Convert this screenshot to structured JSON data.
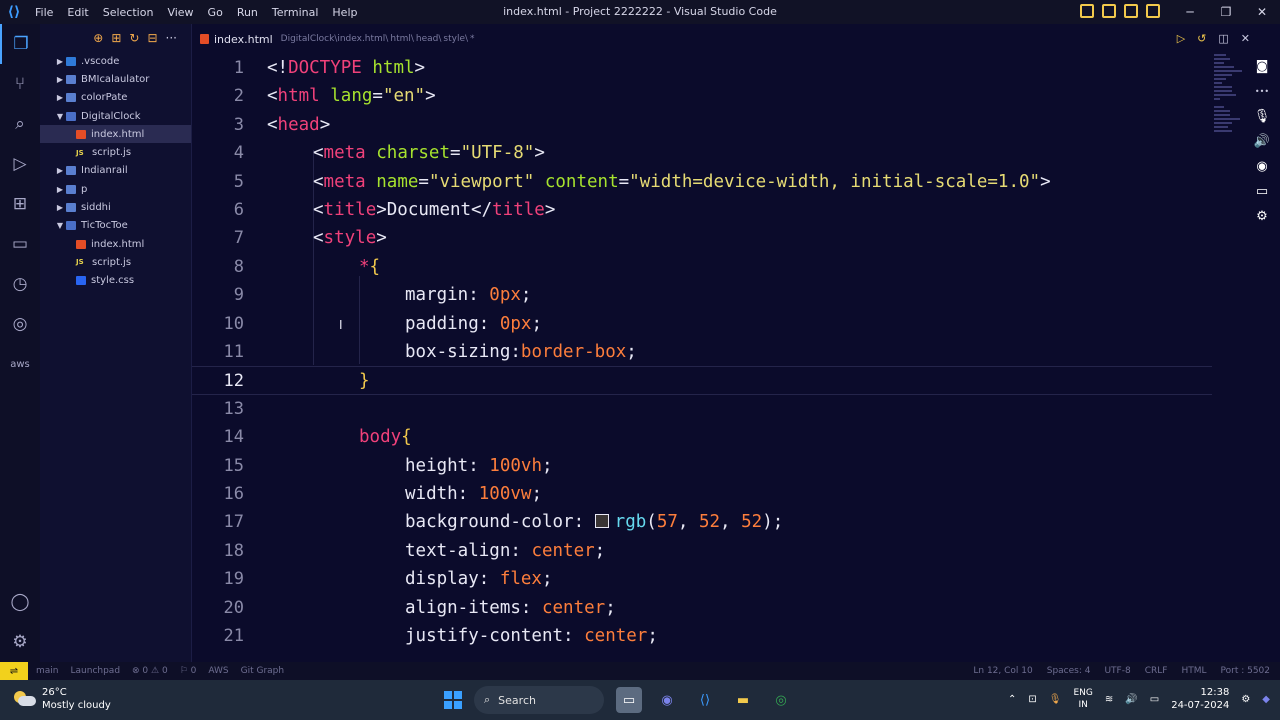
{
  "titlebar": {
    "menu": [
      "File",
      "Edit",
      "Selection",
      "View",
      "Go",
      "Run",
      "Terminal",
      "Help"
    ],
    "window_title": "index.html - Project 2222222 - Visual Studio Code"
  },
  "explorer": {
    "items": [
      {
        "label": ".vscode",
        "type": "folder",
        "depth": 1,
        "open": false
      },
      {
        "label": "BMIcalaulator",
        "type": "folder",
        "depth": 1,
        "open": false
      },
      {
        "label": "colorPate",
        "type": "folder",
        "depth": 1,
        "open": false
      },
      {
        "label": "DigitalClock",
        "type": "folder",
        "depth": 1,
        "open": true
      },
      {
        "label": "index.html",
        "type": "html",
        "depth": 2,
        "selected": true
      },
      {
        "label": "script.js",
        "type": "js",
        "depth": 2
      },
      {
        "label": "Indianrail",
        "type": "folder",
        "depth": 1,
        "open": false
      },
      {
        "label": "p",
        "type": "folder",
        "depth": 1,
        "open": false
      },
      {
        "label": "siddhi",
        "type": "folder",
        "depth": 1,
        "open": false
      },
      {
        "label": "TicTocToe",
        "type": "folder",
        "depth": 1,
        "open": true
      },
      {
        "label": "index.html",
        "type": "html",
        "depth": 2
      },
      {
        "label": "script.js",
        "type": "js",
        "depth": 2
      },
      {
        "label": "style.css",
        "type": "css",
        "depth": 2
      }
    ]
  },
  "tab": {
    "label": "index.html",
    "breadcrumb": [
      "DigitalClock\\index.html\\",
      "html\\",
      "head\\",
      "style\\",
      "*"
    ]
  },
  "editor": {
    "current_line": 12,
    "lines": [
      {
        "n": "1",
        "indent": 0,
        "tokens": [
          [
            "punc",
            "<!"
          ],
          [
            "doctype",
            "DOCTYPE"
          ],
          [
            "punc",
            " "
          ],
          [
            "attr",
            "html"
          ],
          [
            "punc",
            ">"
          ]
        ]
      },
      {
        "n": "2",
        "indent": 0,
        "tokens": [
          [
            "punc",
            "<"
          ],
          [
            "tag",
            "html"
          ],
          [
            "punc",
            " "
          ],
          [
            "attr",
            "lang"
          ],
          [
            "punc",
            "="
          ],
          [
            "str",
            "\"en\""
          ],
          [
            "punc",
            ">"
          ]
        ]
      },
      {
        "n": "3",
        "indent": 0,
        "tokens": [
          [
            "punc",
            "<"
          ],
          [
            "tag",
            "head"
          ],
          [
            "punc",
            ">"
          ]
        ]
      },
      {
        "n": "4",
        "indent": 1,
        "tokens": [
          [
            "punc",
            "<"
          ],
          [
            "tag",
            "meta"
          ],
          [
            "punc",
            " "
          ],
          [
            "attr",
            "charset"
          ],
          [
            "punc",
            "="
          ],
          [
            "str",
            "\"UTF-8\""
          ],
          [
            "punc",
            ">"
          ]
        ]
      },
      {
        "n": "5",
        "indent": 1,
        "tokens": [
          [
            "punc",
            "<"
          ],
          [
            "tag",
            "meta"
          ],
          [
            "punc",
            " "
          ],
          [
            "attr",
            "name"
          ],
          [
            "punc",
            "="
          ],
          [
            "str",
            "\"viewport\""
          ],
          [
            "punc",
            " "
          ],
          [
            "attr",
            "content"
          ],
          [
            "punc",
            "="
          ],
          [
            "str",
            "\"width=device-width, initial-scale=1.0\""
          ],
          [
            "punc",
            ">"
          ]
        ]
      },
      {
        "n": "6",
        "indent": 1,
        "tokens": [
          [
            "punc",
            "<"
          ],
          [
            "tag",
            "title"
          ],
          [
            "punc",
            ">Document</"
          ],
          [
            "tag",
            "title"
          ],
          [
            "punc",
            ">"
          ]
        ]
      },
      {
        "n": "7",
        "indent": 1,
        "tokens": [
          [
            "punc",
            "<"
          ],
          [
            "tag",
            "style"
          ],
          [
            "punc",
            ">"
          ]
        ]
      },
      {
        "n": "8",
        "indent": 2,
        "tokens": [
          [
            "sel",
            "*"
          ],
          [
            "brace",
            "{"
          ]
        ]
      },
      {
        "n": "9",
        "indent": 3,
        "tokens": [
          [
            "prop",
            "margin: "
          ],
          [
            "num",
            "0"
          ],
          [
            "val",
            "px"
          ],
          [
            "punc",
            ";"
          ]
        ]
      },
      {
        "n": "10",
        "indent": 3,
        "tokens": [
          [
            "prop",
            "padding: "
          ],
          [
            "num",
            "0"
          ],
          [
            "val",
            "px"
          ],
          [
            "punc",
            ";"
          ]
        ]
      },
      {
        "n": "11",
        "indent": 3,
        "tokens": [
          [
            "prop",
            "box-sizing:"
          ],
          [
            "val",
            "border-box"
          ],
          [
            "punc",
            ";"
          ]
        ]
      },
      {
        "n": "12",
        "indent": 2,
        "tokens": [
          [
            "brace",
            "}"
          ]
        ]
      },
      {
        "n": "13",
        "indent": 0,
        "tokens": []
      },
      {
        "n": "14",
        "indent": 2,
        "tokens": [
          [
            "sel",
            "body"
          ],
          [
            "brace",
            "{"
          ]
        ]
      },
      {
        "n": "15",
        "indent": 3,
        "tokens": [
          [
            "prop",
            "height: "
          ],
          [
            "num",
            "100"
          ],
          [
            "val",
            "vh"
          ],
          [
            "punc",
            ";"
          ]
        ]
      },
      {
        "n": "16",
        "indent": 3,
        "tokens": [
          [
            "prop",
            "width: "
          ],
          [
            "num",
            "100"
          ],
          [
            "val",
            "vw"
          ],
          [
            "punc",
            ";"
          ]
        ]
      },
      {
        "n": "17",
        "indent": 3,
        "tokens": [
          [
            "prop",
            "background-color: "
          ],
          [
            "swatch",
            ""
          ],
          [
            "fn",
            "rgb"
          ],
          [
            "punc",
            "("
          ],
          [
            "num",
            "57"
          ],
          [
            "punc",
            ", "
          ],
          [
            "num",
            "52"
          ],
          [
            "punc",
            ", "
          ],
          [
            "num",
            "52"
          ],
          [
            "punc",
            ");"
          ]
        ]
      },
      {
        "n": "18",
        "indent": 3,
        "tokens": [
          [
            "prop",
            "text-align: "
          ],
          [
            "val",
            "center"
          ],
          [
            "punc",
            ";"
          ]
        ]
      },
      {
        "n": "19",
        "indent": 3,
        "tokens": [
          [
            "prop",
            "display: "
          ],
          [
            "val",
            "flex"
          ],
          [
            "punc",
            ";"
          ]
        ]
      },
      {
        "n": "20",
        "indent": 3,
        "tokens": [
          [
            "prop",
            "align-items: "
          ],
          [
            "val",
            "center"
          ],
          [
            "punc",
            ";"
          ]
        ]
      },
      {
        "n": "21",
        "indent": 3,
        "tokens": [
          [
            "prop",
            "justify-content: "
          ],
          [
            "val",
            "center"
          ],
          [
            "punc",
            ";"
          ]
        ]
      }
    ]
  },
  "statusbar": {
    "left": [
      "main",
      "Launchpad",
      "⊗ 0 ⚠ 0",
      "⚐ 0",
      "AWS",
      "Git Graph"
    ],
    "right": [
      "Ln 12, Col 10",
      "Spaces: 4",
      "UTF-8",
      "CRLF",
      "HTML",
      "Port : 5502"
    ]
  },
  "taskbar": {
    "temperature": "26°C",
    "weather": "Mostly cloudy",
    "search_label": "Search",
    "lang_top": "ENG",
    "lang_bottom": "IN",
    "time": "12:38",
    "date": "24-07-2024"
  },
  "colors": {
    "editor_bg": "#0b0b2b",
    "tag": "#f0417a",
    "attr": "#a6e22e",
    "string": "#e6db74",
    "number": "#fd7e3c",
    "accent": "#4aa3ff",
    "remote_indicator": "#f2d11c"
  }
}
